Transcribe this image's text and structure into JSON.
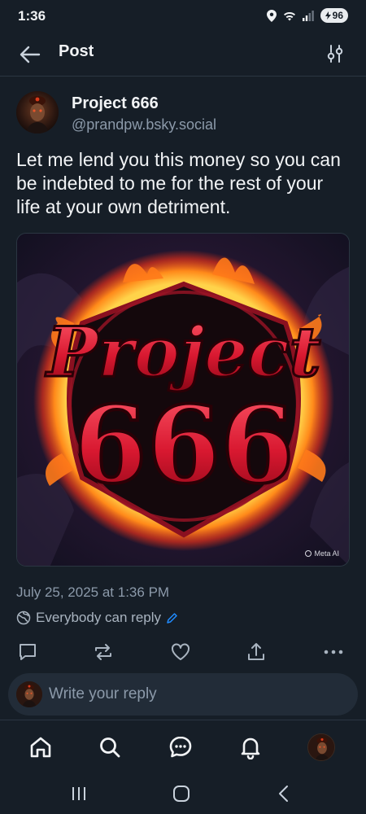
{
  "status": {
    "time": "1:36",
    "battery": "96",
    "icons": [
      "location-icon",
      "wifi-icon",
      "signal-icon",
      "battery-icon"
    ]
  },
  "header": {
    "title": "Post",
    "back_icon": "arrow-left-icon",
    "filter_icon": "sliders-icon"
  },
  "post": {
    "author_name": "Project 666",
    "author_handle": "@prandpw.bsky.social",
    "text": "Let me lend you this money so you can be indebted to me for the rest of your life at your own detriment.",
    "image": {
      "logo_word": "Project",
      "logo_number": "666",
      "watermark": "Meta AI"
    },
    "date": "July 25, 2025 at 1:36 PM",
    "reply_permission": "Everybody can reply"
  },
  "actions": [
    "reply-icon",
    "repost-icon",
    "like-icon",
    "share-icon",
    "more-icon"
  ],
  "reply_box": {
    "placeholder": "Write your reply"
  },
  "bottom_nav": [
    "home-icon",
    "search-icon",
    "chat-icon",
    "notifications-icon",
    "profile-avatar"
  ],
  "colors": {
    "background": "#161e27",
    "text": "#f1f3f5",
    "muted": "#8c9aaa",
    "accent": "#208bfe"
  }
}
